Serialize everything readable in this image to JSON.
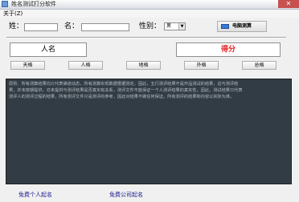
{
  "window": {
    "title": "姓名测试打分软件",
    "close_glyph": "✕"
  },
  "menu": {
    "about": "关于(Z)"
  },
  "form": {
    "surname_label": "姓：",
    "given_name_label": "名：",
    "gender_label": "性别：",
    "gender_value": "男",
    "gender_arrow": "▼",
    "calc_button": "电脑测算"
  },
  "results": {
    "name_title": "人名",
    "score_title": "得分",
    "grids": [
      "天格",
      "人格",
      "地格",
      "外格",
      "总格"
    ],
    "description": "原则：所有测算结果均只代表弹道动态，所有测算实现数据根据测定，因此，五行测评结果不是作品测试的结果，这与测评结果，并未按期提供，亦未提供与测评结果是否真实有关系，测评文件不能保证一个人测评结果的真实性，因此，测试结果只代表测评人的测评过程的结果，所有测评文件只是测评的参考，因此对结果不做任何保证。所有测评的结果和内容以实际为准。"
  },
  "links": {
    "personal": "免费个人起名",
    "company": "免费公司起名"
  }
}
